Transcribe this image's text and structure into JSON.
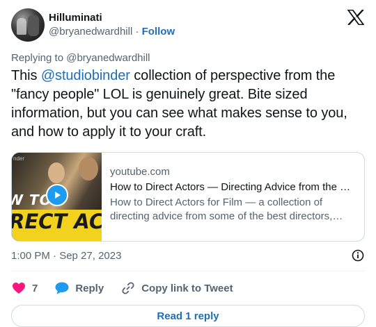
{
  "author": {
    "name": "Hilluminati",
    "handle": "@bryanedwardhill",
    "separator": "·",
    "follow_label": "Follow"
  },
  "replying_to": "Replying to @bryanedwardhill",
  "tweet": {
    "text_before": "This ",
    "mention": "@studiobinder",
    "text_after": " collection of perspective from the \"fancy people\" LOL is genuinely great. Bite sized information, but you can see what makes sense to you, and how to apply it to your craft."
  },
  "link_card": {
    "domain": "youtube.com",
    "title": "How to Direct Actors — Directing Advice from the Greatest Directors",
    "description": "How to Direct Actors for Film — a collection of directing advice from some of the best directors, including insight and techniques.",
    "thumb_text_1": "W TO",
    "thumb_text_2": "RECT ACTOR",
    "thumb_brand": "nder"
  },
  "timestamp": "1:00 PM · Sep 27, 2023",
  "actions": {
    "like_count": "7",
    "reply_label": "Reply",
    "copy_label": "Copy link to Tweet"
  },
  "read_reply_label": "Read 1 reply",
  "colors": {
    "link": "#1d6fb8",
    "like": "#f91880",
    "reply_icon": "#1d9bf0",
    "muted": "#536471"
  }
}
